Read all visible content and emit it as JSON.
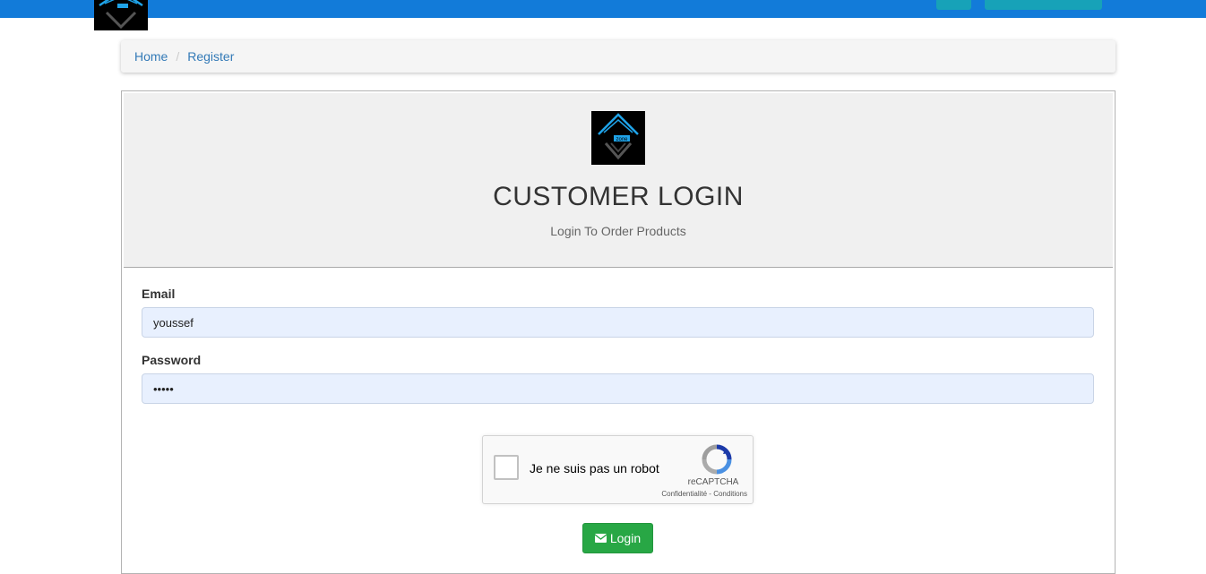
{
  "breadcrumb": {
    "home": "Home",
    "separator": "/",
    "current": "Register"
  },
  "panel": {
    "title": "CUSTOMER LOGIN",
    "subtitle": "Login To Order Products",
    "logo_text": "zone"
  },
  "form": {
    "email_label": "Email",
    "email_value": "youssef",
    "password_label": "Password",
    "password_value": "•••••"
  },
  "captcha": {
    "text": "Je ne suis pas un robot",
    "brand": "reCAPTCHA",
    "privacy": "Confidentialité",
    "dot": "-",
    "terms": "Conditions"
  },
  "login_button": {
    "label": "Login",
    "icon": "envelope-icon"
  },
  "colors": {
    "topbar": "#127bd9",
    "accent_teal": "#17a2b8",
    "login_green": "#28a745",
    "link": "#337ab7"
  }
}
